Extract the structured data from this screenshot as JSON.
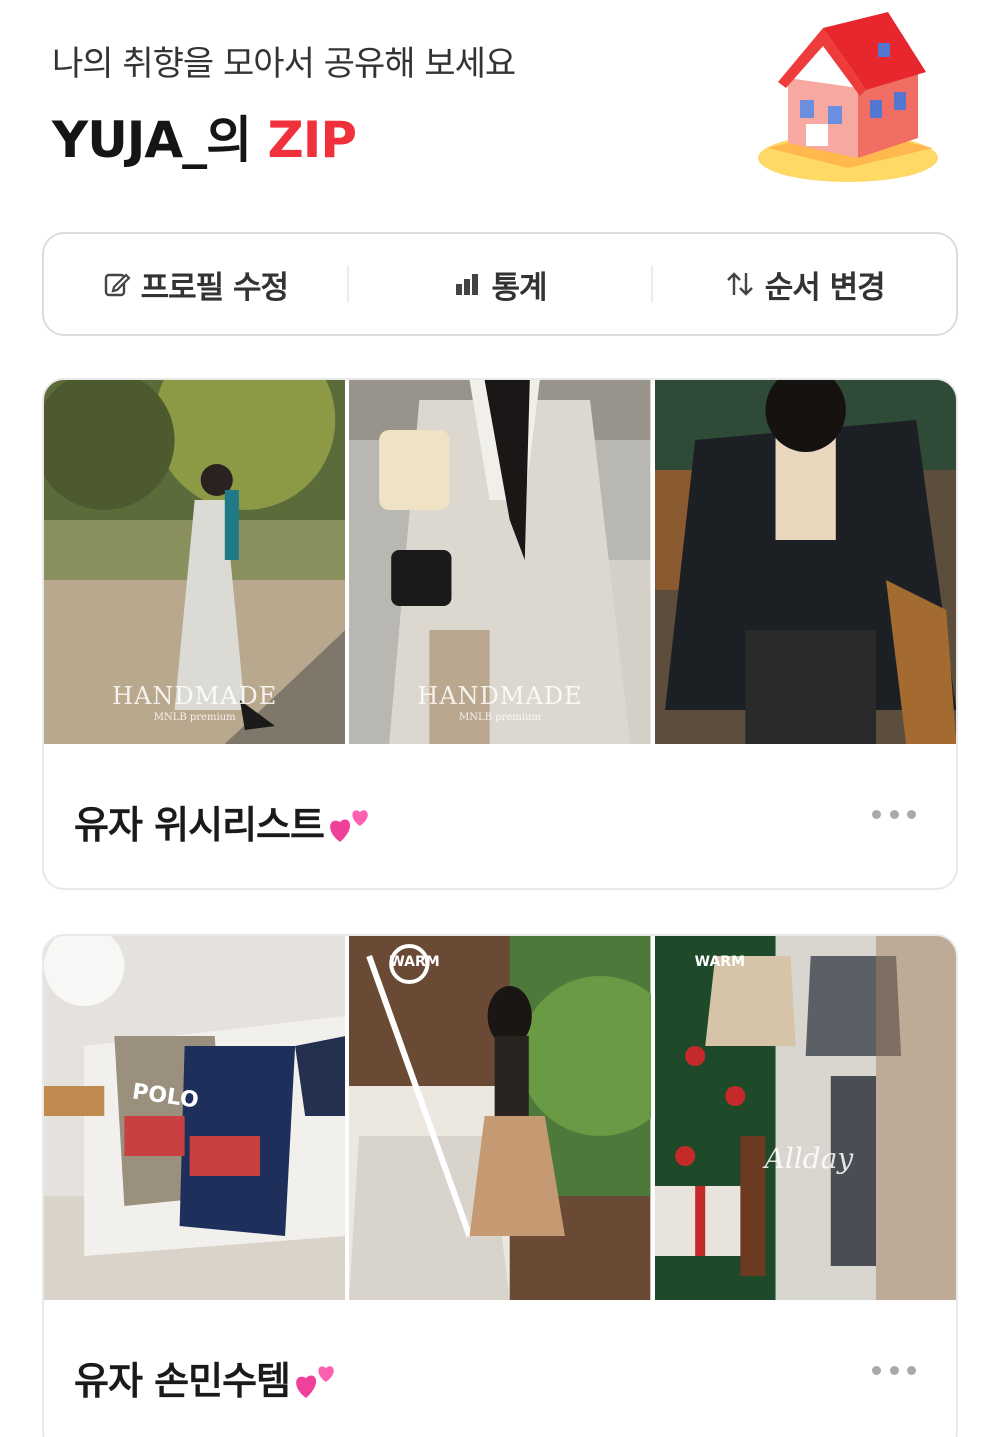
{
  "header": {
    "subtitle": "나의 취향을 모아서 공유해 보세요",
    "title_prefix": "YUJA_의 ",
    "title_accent": "ZIP",
    "accent_color": "#f0313b"
  },
  "actions": [
    {
      "label": "프로필 수정",
      "icon": "edit-icon"
    },
    {
      "label": "통계",
      "icon": "bar-chart-icon"
    },
    {
      "label": "순서 변경",
      "icon": "sort-arrows-icon"
    }
  ],
  "collections": [
    {
      "title": "유자 위시리스트",
      "thumbs": [
        {
          "watermark": "HANDMADE",
          "watermark_sub": "MNLB premium"
        },
        {
          "watermark": "HANDMADE",
          "watermark_sub": "MNLB premium"
        },
        {
          "watermark": "",
          "watermark_sub": ""
        }
      ]
    },
    {
      "title": "유자 손민수템",
      "thumbs": [
        {
          "badge": "",
          "logo": "POLO"
        },
        {
          "badge": "WARM"
        },
        {
          "badge": "WARM",
          "overlay": "Allday"
        }
      ]
    }
  ]
}
